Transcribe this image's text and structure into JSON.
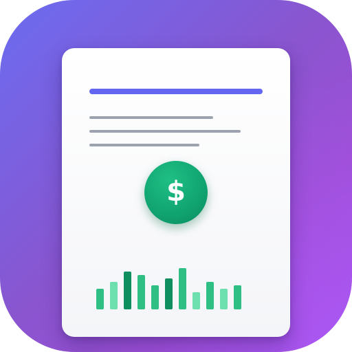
{
  "icon": {
    "name": "financial-document-app-icon",
    "symbol_icon": "dollar-sign-icon",
    "symbol": "$"
  },
  "colors": {
    "background_start": "#6b6cf0",
    "background_end": "#a855f0",
    "card": "#ffffff",
    "title_bar": "#6366f1",
    "text_lines": "#9ca3af",
    "coin": "#10a370",
    "bar_light": "#6ee0b0",
    "bar_mid": "#2fbf85",
    "bar_dark": "#0f8f5f"
  },
  "chart_data": {
    "type": "bar",
    "values": [
      30,
      40,
      55,
      50,
      35,
      45,
      60,
      25,
      40,
      30,
      35
    ],
    "shades": [
      "mid",
      "light",
      "dark",
      "mid",
      "mid",
      "dark",
      "mid",
      "light",
      "mid",
      "light",
      "mid"
    ]
  }
}
